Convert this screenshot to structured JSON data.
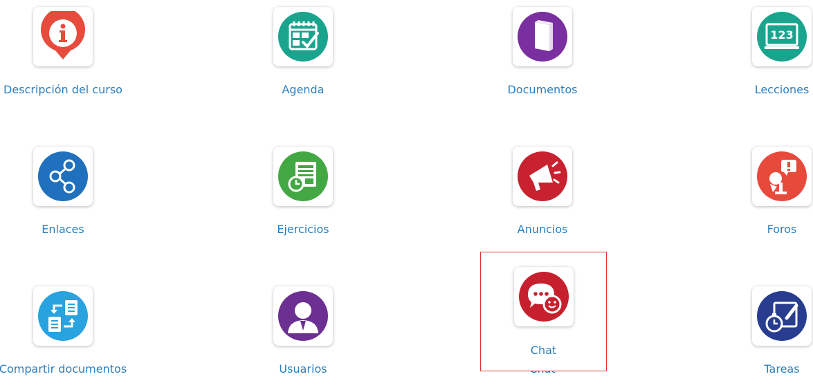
{
  "tools": [
    {
      "label": "Descripción del curso",
      "icon": "info-icon",
      "color": "#e74b3c"
    },
    {
      "label": "Agenda",
      "icon": "calendar-icon",
      "color": "#1aa48e"
    },
    {
      "label": "Documentos",
      "icon": "book-icon",
      "color": "#7a2fa0"
    },
    {
      "label": "Lecciones",
      "icon": "lesson-screen-icon",
      "color": "#1aa48e"
    },
    {
      "label": "Enlaces",
      "icon": "share-icon",
      "color": "#1f70bd"
    },
    {
      "label": "Ejercicios",
      "icon": "exercise-icon",
      "color": "#43a844"
    },
    {
      "label": "Anuncios",
      "icon": "megaphone-icon",
      "color": "#c8212f"
    },
    {
      "label": "Foros",
      "icon": "forum-icon",
      "color": "#e7493b"
    },
    {
      "label": "Compartir documentos",
      "icon": "share-documents-icon",
      "color": "#29a3e0"
    },
    {
      "label": "Usuarios",
      "icon": "user-icon",
      "color": "#6c2f92"
    },
    {
      "label": "Chat",
      "icon": "chat-icon",
      "color": "#c6202f"
    },
    {
      "label": "Tareas",
      "icon": "tasks-icon",
      "color": "#283d8f"
    }
  ],
  "highlight": {
    "label": "Chat",
    "border_color": "#e0342b"
  }
}
